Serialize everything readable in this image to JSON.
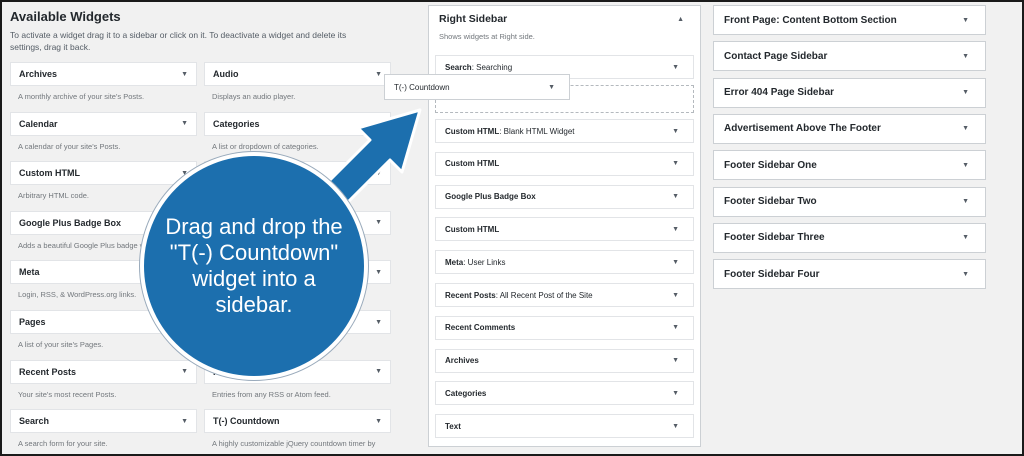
{
  "available": {
    "title": "Available Widgets",
    "description": "To activate a widget drag it to a sidebar or click on it. To deactivate a widget and delete its settings, drag it back.",
    "widgets": [
      {
        "label": "Archives",
        "desc": "A monthly archive of your site's Posts."
      },
      {
        "label": "Audio",
        "desc": "Displays an audio player."
      },
      {
        "label": "Calendar",
        "desc": "A calendar of your site's Posts."
      },
      {
        "label": "Categories",
        "desc": "A list or dropdown of categories."
      },
      {
        "label": "Custom HTML",
        "desc": "Arbitrary HTML code."
      },
      {
        "label": "",
        "desc": ""
      },
      {
        "label": "Google Plus Badge Box",
        "desc": "Adds a beautiful Google Plus badge w"
      },
      {
        "label": "",
        "desc": ""
      },
      {
        "label": "Meta",
        "desc": "Login, RSS, & WordPress.org links."
      },
      {
        "label": "",
        "desc": ""
      },
      {
        "label": "Pages",
        "desc": "A list of your site's Pages."
      },
      {
        "label": "",
        "desc": "nts."
      },
      {
        "label": "Recent Posts",
        "desc": "Your site's most recent Posts."
      },
      {
        "label": "RSS",
        "desc": "Entries from any RSS or Atom feed."
      },
      {
        "label": "Search",
        "desc": "A search form for your site."
      },
      {
        "label": "T(-) Countdown",
        "desc": "A highly customizable jQuery countdown timer by"
      }
    ]
  },
  "dragging": {
    "label": "T(-) Countdown"
  },
  "right_sidebar": {
    "title": "Right Sidebar",
    "description": "Shows widgets at Right side.",
    "items": [
      {
        "bold": "Search",
        "rest": ": Searching"
      },
      {
        "bold": "Custom HTML",
        "rest": ": Blank HTML Widget"
      },
      {
        "bold": "Custom HTML",
        "rest": ""
      },
      {
        "bold": "Google Plus Badge Box",
        "rest": ""
      },
      {
        "bold": "Custom HTML",
        "rest": ""
      },
      {
        "bold": "Meta",
        "rest": ": User Links"
      },
      {
        "bold": "Recent Posts",
        "rest": ": All Recent Post of the Site"
      },
      {
        "bold": "Recent Comments",
        "rest": ""
      },
      {
        "bold": "Archives",
        "rest": ""
      },
      {
        "bold": "Categories",
        "rest": ""
      },
      {
        "bold": "Text",
        "rest": ""
      }
    ]
  },
  "sidebars": [
    "Front Page: Content Bottom Section",
    "Contact Page Sidebar",
    "Error 404 Page Sidebar",
    "Advertisement Above The Footer",
    "Footer Sidebar One",
    "Footer Sidebar Two",
    "Footer Sidebar Three",
    "Footer Sidebar Four"
  ],
  "callout": {
    "text": "Drag and drop the \"T(-) Countdown\" widget into a sidebar."
  },
  "icons": {
    "collapse": "caret-up-icon",
    "expand": "caret-down-icon"
  },
  "colors": {
    "callout": "#1c6fae",
    "background": "#f1f1f1"
  }
}
